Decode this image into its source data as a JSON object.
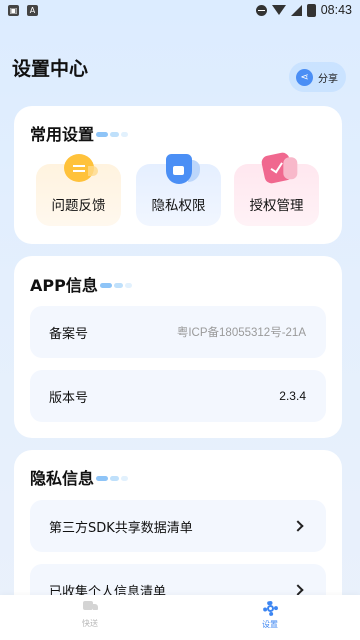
{
  "status_bar": {
    "time": "08:43",
    "left_icons": [
      "notification-icon",
      "app-icon"
    ],
    "right_icons": [
      "dnd-icon",
      "wifi-icon",
      "signal-icon",
      "battery-icon"
    ]
  },
  "header": {
    "title": "设置中心",
    "share_label": "分享"
  },
  "common_settings": {
    "title": "常用设置",
    "items": [
      {
        "label": "问题反馈",
        "icon": "feedback-bubble-icon",
        "color": "#ffc23b"
      },
      {
        "label": "隐私权限",
        "icon": "privacy-shield-icon",
        "color": "#4b8ff5"
      },
      {
        "label": "授权管理",
        "icon": "authorization-check-icon",
        "color": "#f0688f"
      }
    ]
  },
  "app_info": {
    "title": "APP信息",
    "rows": [
      {
        "label": "备案号",
        "value": "粤ICP备18055312号-21A"
      },
      {
        "label": "版本号",
        "value": "2.3.4"
      }
    ]
  },
  "privacy_info": {
    "title": "隐私信息",
    "rows": [
      {
        "label": "第三方SDK共享数据清单"
      },
      {
        "label": "已收集个人信息清单"
      }
    ]
  },
  "bottom_nav": {
    "items": [
      {
        "label": "快送",
        "icon": "truck-icon",
        "active": false
      },
      {
        "label": "设置",
        "icon": "gear-icon",
        "active": true
      }
    ],
    "active_color": "#3d86f2"
  }
}
